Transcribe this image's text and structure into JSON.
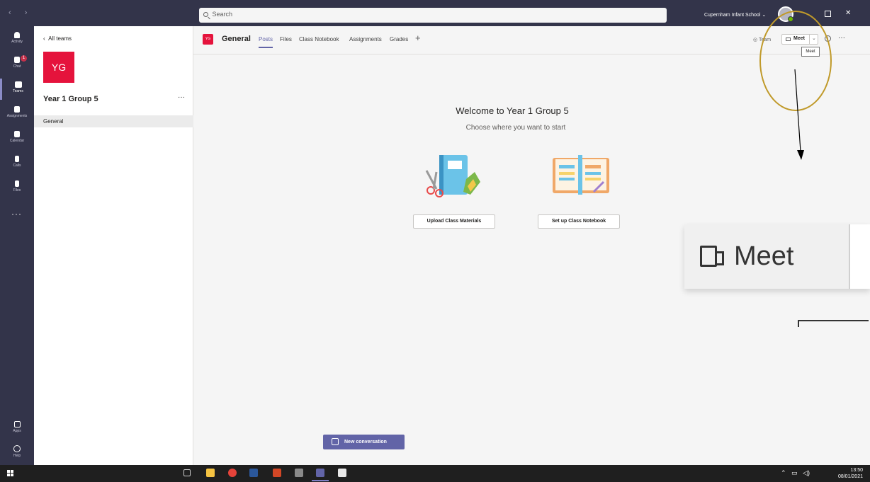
{
  "titlebar": {
    "search_placeholder": "Search",
    "org_name": "Cupernham Infant School ⌄"
  },
  "rail": {
    "items": [
      {
        "label": "Activity",
        "icon": "bell-icon"
      },
      {
        "label": "Chat",
        "icon": "chat-icon",
        "badge": "1"
      },
      {
        "label": "Teams",
        "icon": "teams-icon"
      },
      {
        "label": "Assignments",
        "icon": "assignments-icon"
      },
      {
        "label": "Calendar",
        "icon": "calendar-icon"
      },
      {
        "label": "Calls",
        "icon": "phone-icon"
      },
      {
        "label": "Files",
        "icon": "file-icon"
      },
      {
        "label": "Apps",
        "icon": "apps-icon"
      },
      {
        "label": "Help",
        "icon": "help-icon"
      }
    ],
    "more": "···"
  },
  "sidebar": {
    "back": "All teams",
    "team_initials": "YG",
    "team_name": "Year 1 Group 5",
    "more": "···",
    "channels": [
      "General"
    ]
  },
  "header": {
    "initials": "YG",
    "channel_name": "General",
    "tabs": [
      "Posts",
      "Files",
      "Class Notebook",
      "Assignments",
      "Grades"
    ],
    "add_tab": "+",
    "team_label": "Team",
    "meet_label": "Meet",
    "info": "i",
    "more": "···",
    "tooltip": "Meet"
  },
  "welcome": {
    "title": "Welcome to Year 1 Group 5",
    "subtitle": "Choose where you want to start",
    "upload_button": "Upload Class Materials",
    "notebook_button": "Set up Class Notebook"
  },
  "new_conversation": "New conversation",
  "annotation": {
    "zoom_label": "Meet",
    "oval_color": "#c09a2a"
  },
  "taskbar": {
    "time": "13:50",
    "date": "08/01/2021"
  },
  "colors": {
    "accent": "#6264a7",
    "team_tile": "#e5133c",
    "titlebar": "#33344a"
  }
}
